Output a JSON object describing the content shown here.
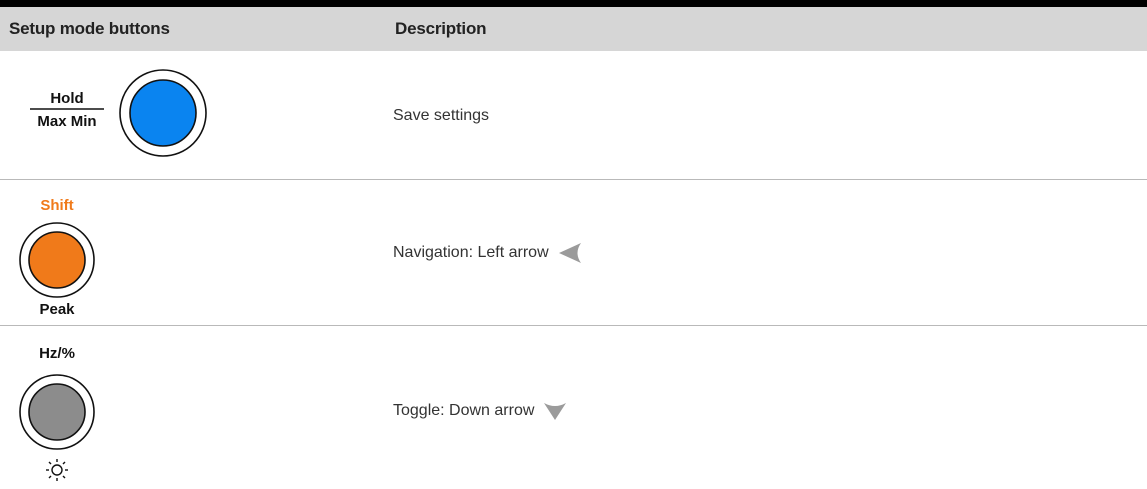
{
  "table": {
    "headers": [
      "Setup mode buttons",
      "Description"
    ],
    "rows": [
      {
        "button": {
          "top_label": "Hold",
          "bottom_label": "Max Min",
          "color": "#0a84f0"
        },
        "description": "Save settings"
      },
      {
        "button": {
          "top_label": "Shift",
          "bottom_label": "Peak",
          "color": "#f07a1a",
          "top_label_color": "#f07a1a"
        },
        "description": "Navigation: Left arrow",
        "arrow_icon": "left-arrow-icon"
      },
      {
        "button": {
          "top_label": "Hz/%",
          "bottom_icon": "backlight-sun-icon",
          "color": "#8c8c8c"
        },
        "description": "Toggle: Down arrow",
        "arrow_icon": "down-arrow-icon"
      }
    ]
  }
}
